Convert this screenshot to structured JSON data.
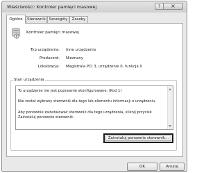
{
  "window": {
    "title": "Właściwości: Kontroler pamięci masowej",
    "help_glyph": "?",
    "close_glyph": "×"
  },
  "tabs": [
    {
      "label": "Ogólne",
      "active": true
    },
    {
      "label": "Sterownik",
      "active": false
    },
    {
      "label": "Szczegóły",
      "active": false
    },
    {
      "label": "Zasoby",
      "active": false
    }
  ],
  "device": {
    "name": "Kontroler pamięci masowej",
    "icon": "device-warning-icon"
  },
  "properties": [
    {
      "label": "Typ urządzenia:",
      "value": "Inne urządzenia"
    },
    {
      "label": "Producent:",
      "value": "Nieznany"
    },
    {
      "label": "Lokalizacja:",
      "value": "Magistrala PCI 3, urządzenie 0, funkcja 0"
    }
  ],
  "status": {
    "group_label": "Stan urządzenia",
    "lines": [
      "To urządzenie nie jest poprawnie skonfigurowane. (Kod 1)",
      "",
      "Nie został wybrany sterownik dla tego lub elementu informacji o urządzeniu.",
      "",
      "Aby ponownie zainstalować sterownik dla tego urządzenia, kliknij przycisk",
      "Zainstaluj ponownie sterownik."
    ],
    "reinstall_button": "Zainstaluj ponownie sterownik..."
  },
  "buttons": {
    "ok": "OK",
    "cancel": "Anuluj"
  }
}
